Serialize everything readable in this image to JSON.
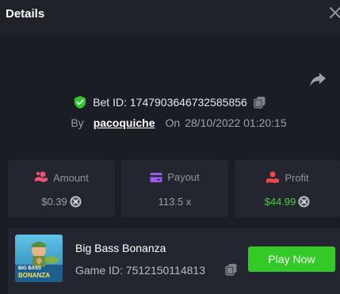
{
  "header": {
    "title": "Details"
  },
  "bet": {
    "id_label": "Bet ID:",
    "id_value": "1747903646732585856",
    "by_label": "By",
    "username": "pacoquiche",
    "on_label": "On",
    "datetime": "28/10/2022 01:20:15"
  },
  "stats": {
    "amount": {
      "label": "Amount",
      "value": "$0.39",
      "color": "#9aa0a8"
    },
    "payout": {
      "label": "Payout",
      "value": "113.5 x",
      "color": "#9aa0a8"
    },
    "profit": {
      "label": "Profit",
      "value": "$44.99",
      "color": "#3ed332"
    }
  },
  "game": {
    "name": "Big Bass Bonanza",
    "id_label": "Game ID:",
    "id_value": "7512150114813",
    "thumb_line1": "BIG BASS",
    "thumb_line2": "BONANZA",
    "play_label": "Play Now"
  },
  "colors": {
    "background": "#1a1d24",
    "card": "#23262e",
    "accent_green": "#34c926",
    "shield_green": "#2fc92a",
    "amount_icon": "#f0507a",
    "payout_icon": "#9b5cf5",
    "profit_icon": "#f0464e"
  },
  "icons": [
    "close-icon",
    "share-icon",
    "shield-check-icon",
    "copy-icon",
    "coins-icon",
    "card-icon",
    "hand-coin-icon",
    "currency-coin-icon"
  ]
}
